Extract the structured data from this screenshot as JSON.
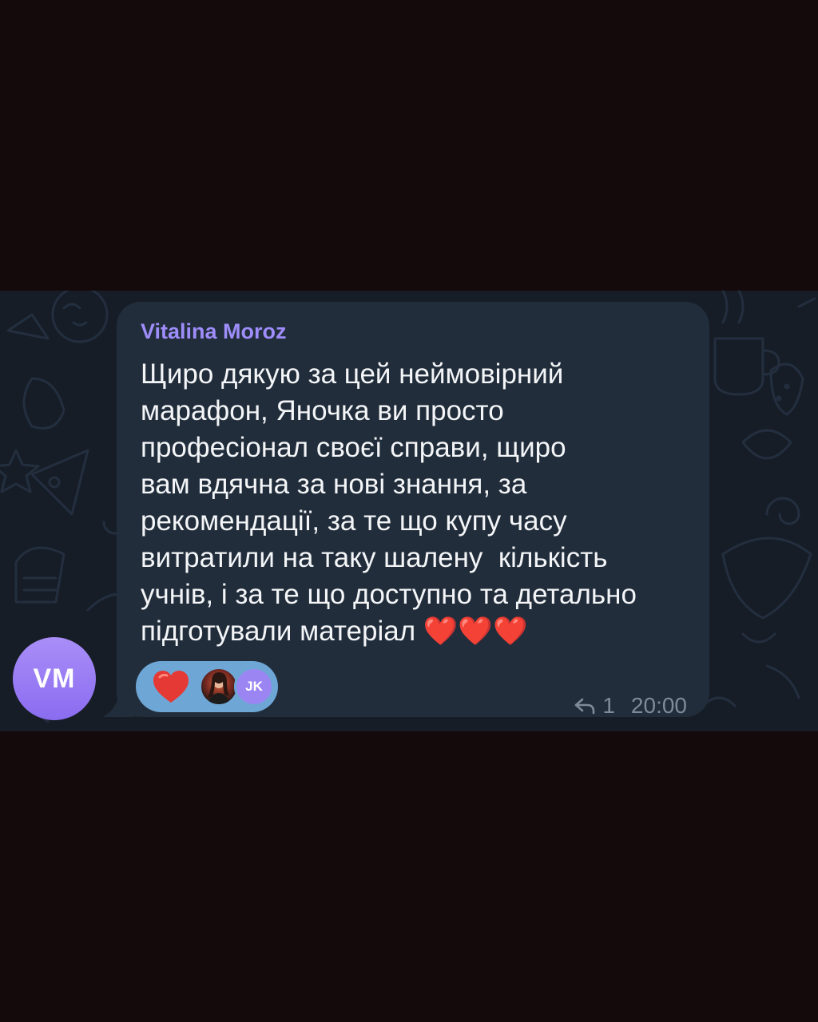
{
  "message": {
    "sender_name": "Vitalina Moroz",
    "text": "Щиро дякую за цей неймовірний\nмарафон, Яночка ви просто\nпрофесіонал своєї справи, щиро\nвам вдячна за нові знання, за\nрекомендації, за те що купу часу\nвитратили на таку шалену  кількість\nучнів, і за те що доступно та детально\nпідготували матеріал ❤️❤️❤️",
    "reply_count": "1",
    "time": "20:00"
  },
  "sender_avatar": {
    "initials": "VM",
    "color": "#9a7ef5"
  },
  "reactions": [
    {
      "emoji": "heart",
      "reactors": [
        {
          "type": "photo",
          "icon": "person-photo"
        },
        {
          "type": "initials",
          "initials": "JK"
        }
      ]
    }
  ],
  "colors": {
    "background": "#140a0b",
    "chat_background": "#161d27",
    "bubble": "#212d3b",
    "sender_name": "#9e8dfa",
    "message_text": "#f3f5f7",
    "reaction_pill": "#6ea7d6",
    "meta": "#7f8b99",
    "heart": "#e53935"
  }
}
